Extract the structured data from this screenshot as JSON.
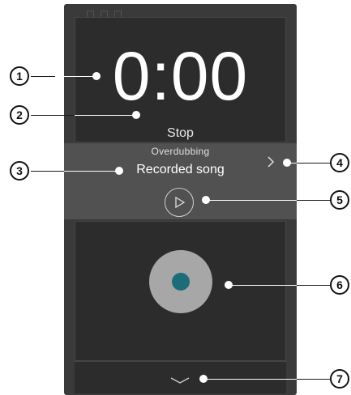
{
  "timer": {
    "value": "0:00",
    "status": "Stop"
  },
  "song": {
    "mode": "Overdubbing",
    "title": "Recorded song",
    "next_icon": "chevron-right-icon",
    "play_icon": "play-icon"
  },
  "record": {
    "icon": "record-icon",
    "dot_color": "#1b6d7a"
  },
  "bottom": {
    "icon": "chevron-down-icon"
  },
  "callouts": [
    "1",
    "2",
    "3",
    "4",
    "5",
    "6",
    "7"
  ]
}
